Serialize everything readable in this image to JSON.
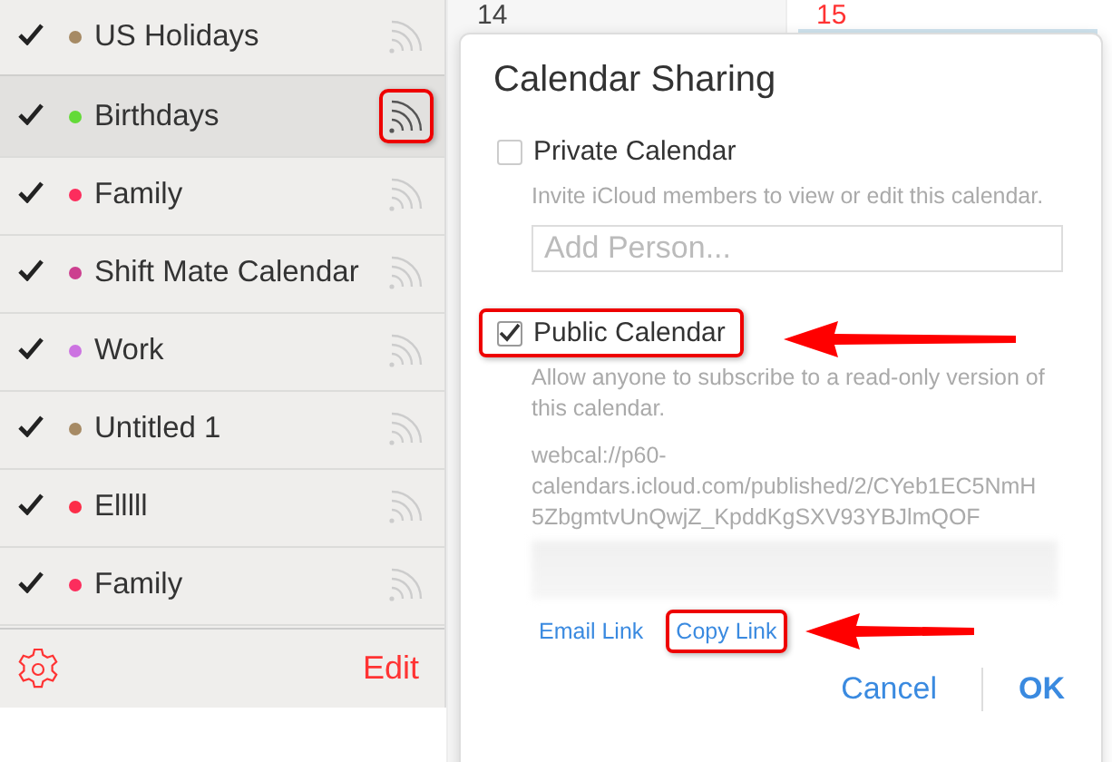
{
  "calendars": [
    {
      "name": "US Holidays",
      "color": "#a68a64",
      "checked": true,
      "selected": false,
      "highlighted": false
    },
    {
      "name": "Birthdays",
      "color": "#63da38",
      "checked": true,
      "selected": true,
      "highlighted": true
    },
    {
      "name": "Family",
      "color": "#fc2d5d",
      "checked": true,
      "selected": false,
      "highlighted": false
    },
    {
      "name": "Shift Mate Calendar",
      "color": "#cc3f8f",
      "checked": true,
      "selected": false,
      "highlighted": false
    },
    {
      "name": "Work",
      "color": "#cc73e1",
      "checked": true,
      "selected": false,
      "highlighted": false
    },
    {
      "name": "Untitled 1",
      "color": "#a68a64",
      "checked": true,
      "selected": false,
      "highlighted": false
    },
    {
      "name": "Elllll",
      "color": "#fc2d48",
      "checked": true,
      "selected": false,
      "highlighted": false
    },
    {
      "name": "Family",
      "color": "#fc2d5d",
      "checked": true,
      "selected": false,
      "highlighted": false
    }
  ],
  "sidebar_footer": {
    "edit": "Edit"
  },
  "days": [
    {
      "label": "14",
      "today": false
    },
    {
      "label": "15",
      "today": true
    }
  ],
  "popover": {
    "title": "Calendar Sharing",
    "options": [
      {
        "label": "Private Calendar",
        "checked": false,
        "highlighted": false,
        "arrow": false,
        "description": "Invite iCloud members to view or edit this calendar.",
        "placeholder": "Add Person..."
      },
      {
        "label": "Public Calendar",
        "checked": true,
        "highlighted": true,
        "arrow": true,
        "description": "Allow anyone to subscribe to a read-only version of this calendar.",
        "url": "webcal://p60-calendars.icloud.com/published/2/CYeb1EC5NmH5ZbgmtvUnQwjZ_KpddKgSXV93YBJlmQOF"
      }
    ],
    "links": [
      {
        "label": "Email Link",
        "highlighted": false,
        "arrow": false
      },
      {
        "label": "Copy Link",
        "highlighted": true,
        "arrow": true
      }
    ],
    "buttons": [
      {
        "label": "Cancel",
        "bold": false
      },
      {
        "label": "OK",
        "bold": true
      }
    ]
  }
}
